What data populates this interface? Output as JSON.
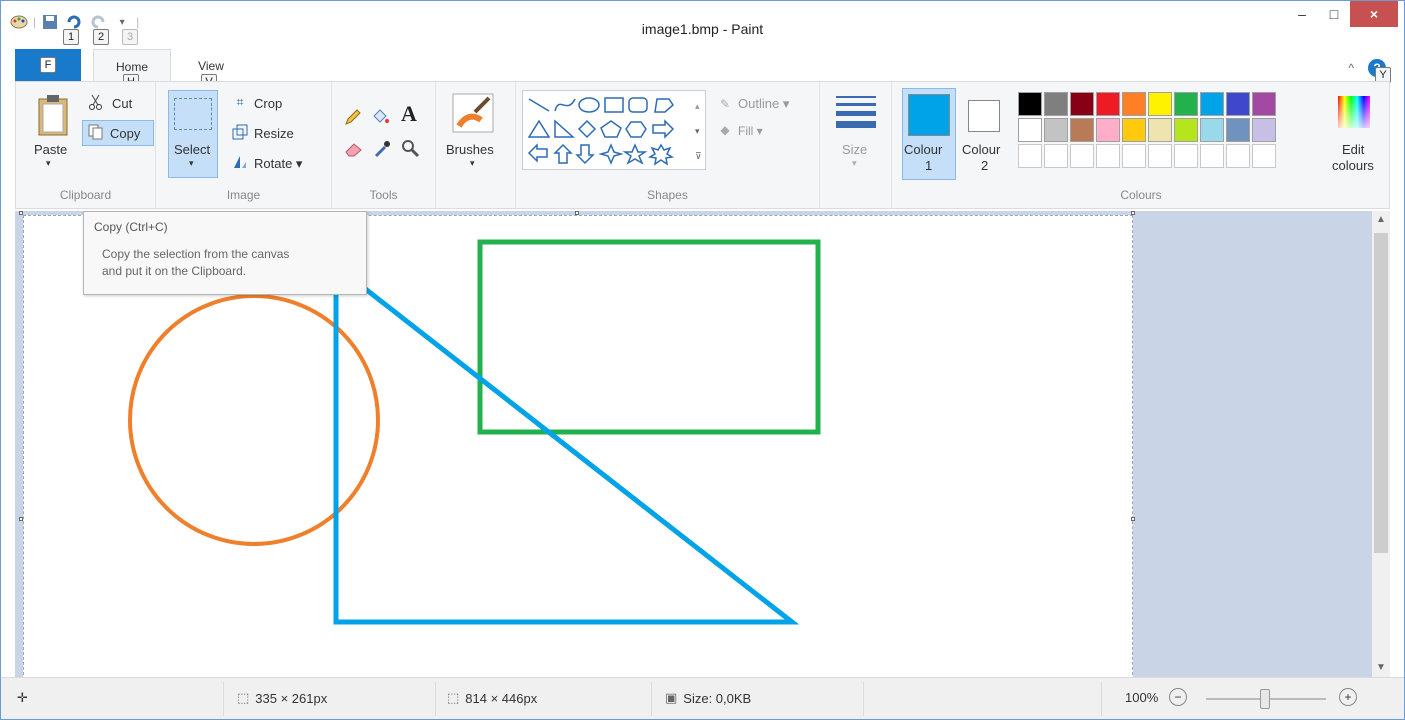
{
  "window": {
    "title": "image1.bmp - Paint",
    "minimize_label": "–",
    "maximize_label": "□",
    "close_label": "×"
  },
  "quick_access": {
    "keytips": [
      "1",
      "2",
      "3"
    ]
  },
  "tabs": {
    "file": {
      "keytip": "F"
    },
    "home": {
      "label": "Home",
      "keytip": "H"
    },
    "view": {
      "label": "View",
      "keytip": "V"
    },
    "help_keytip": "Y"
  },
  "clipboard": {
    "paste": "Paste",
    "cut": "Cut",
    "copy": "Copy",
    "group": "Clipboard"
  },
  "image": {
    "select": "Select",
    "crop": "Crop",
    "resize": "Resize",
    "rotate": "Rotate",
    "group": "Image"
  },
  "tools": {
    "group": "Tools",
    "text_glyph": "A"
  },
  "brushes": {
    "label": "Brushes"
  },
  "shapes": {
    "outline": "Outline",
    "fill": "Fill",
    "group": "Shapes"
  },
  "size": {
    "label": "Size"
  },
  "colours": {
    "colour1": "Colour\n1",
    "colour1_line1": "Colour",
    "colour1_line2": "1",
    "colour2_line1": "Colour",
    "colour2_line2": "2",
    "edit_line1": "Edit",
    "edit_line2": "colours",
    "group": "Colours",
    "colour1_value": "#00a2e8",
    "colour2_value": "#ffffff",
    "palette": [
      "#000000",
      "#7f7f7f",
      "#880015",
      "#ed1c24",
      "#ff7f27",
      "#fff200",
      "#22b14c",
      "#00a2e8",
      "#3f48cc",
      "#a349a4",
      "#ffffff",
      "#c3c3c3",
      "#b97a57",
      "#ffaec9",
      "#ffc90e",
      "#efe4b0",
      "#b5e61d",
      "#99d9ea",
      "#7092be",
      "#c8bfe7",
      "",
      "",
      "",
      "",
      "",
      "",
      "",
      "",
      "",
      ""
    ]
  },
  "tooltip": {
    "title": "Copy (Ctrl+C)",
    "line1": "Copy the selection from the canvas",
    "line2": "and put it on the Clipboard."
  },
  "drawing": {
    "circle_color": "#f07f2b",
    "rect_color": "#22b14c",
    "triangle_color": "#00a2e8"
  },
  "status": {
    "cursor_pos": "",
    "selection_size": "335 × 261px",
    "canvas_size": "814 × 446px",
    "file_size": "Size: 0,0KB",
    "zoom": "100%"
  }
}
